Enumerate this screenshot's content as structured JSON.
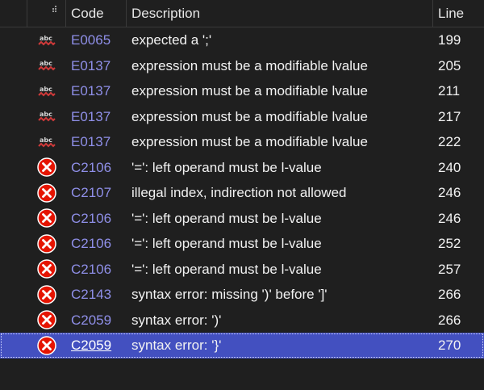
{
  "header": {
    "code": "Code",
    "description": "Description",
    "line": "Line"
  },
  "colors": {
    "background": "#1f1f1f",
    "code_link": "#8f8fe8",
    "selected_row": "#4350c0",
    "error_icon": "#e51400",
    "squiggle": "#d03a3a"
  },
  "rows": [
    {
      "icon": "abc-squiggle-icon",
      "code": "E0065",
      "description": "expected a ';'",
      "line": "199"
    },
    {
      "icon": "abc-squiggle-icon",
      "code": "E0137",
      "description": "expression must be a modifiable lvalue",
      "line": "205"
    },
    {
      "icon": "abc-squiggle-icon",
      "code": "E0137",
      "description": "expression must be a modifiable lvalue",
      "line": "211"
    },
    {
      "icon": "abc-squiggle-icon",
      "code": "E0137",
      "description": "expression must be a modifiable lvalue",
      "line": "217"
    },
    {
      "icon": "abc-squiggle-icon",
      "code": "E0137",
      "description": "expression must be a modifiable lvalue",
      "line": "222"
    },
    {
      "icon": "error-icon",
      "code": "C2106",
      "description": "'=': left operand must be l-value",
      "line": "240"
    },
    {
      "icon": "error-icon",
      "code": "C2107",
      "description": "illegal index, indirection not allowed",
      "line": "246"
    },
    {
      "icon": "error-icon",
      "code": "C2106",
      "description": "'=': left operand must be l-value",
      "line": "246"
    },
    {
      "icon": "error-icon",
      "code": "C2106",
      "description": "'=': left operand must be l-value",
      "line": "252"
    },
    {
      "icon": "error-icon",
      "code": "C2106",
      "description": "'=': left operand must be l-value",
      "line": "257"
    },
    {
      "icon": "error-icon",
      "code": "C2143",
      "description": "syntax error: missing ')' before ']'",
      "line": "266"
    },
    {
      "icon": "error-icon",
      "code": "C2059",
      "description": "syntax error: ')'",
      "line": "266"
    },
    {
      "icon": "error-icon",
      "code": "C2059",
      "description": "syntax error: '}'",
      "line": "270",
      "selected": true
    }
  ]
}
